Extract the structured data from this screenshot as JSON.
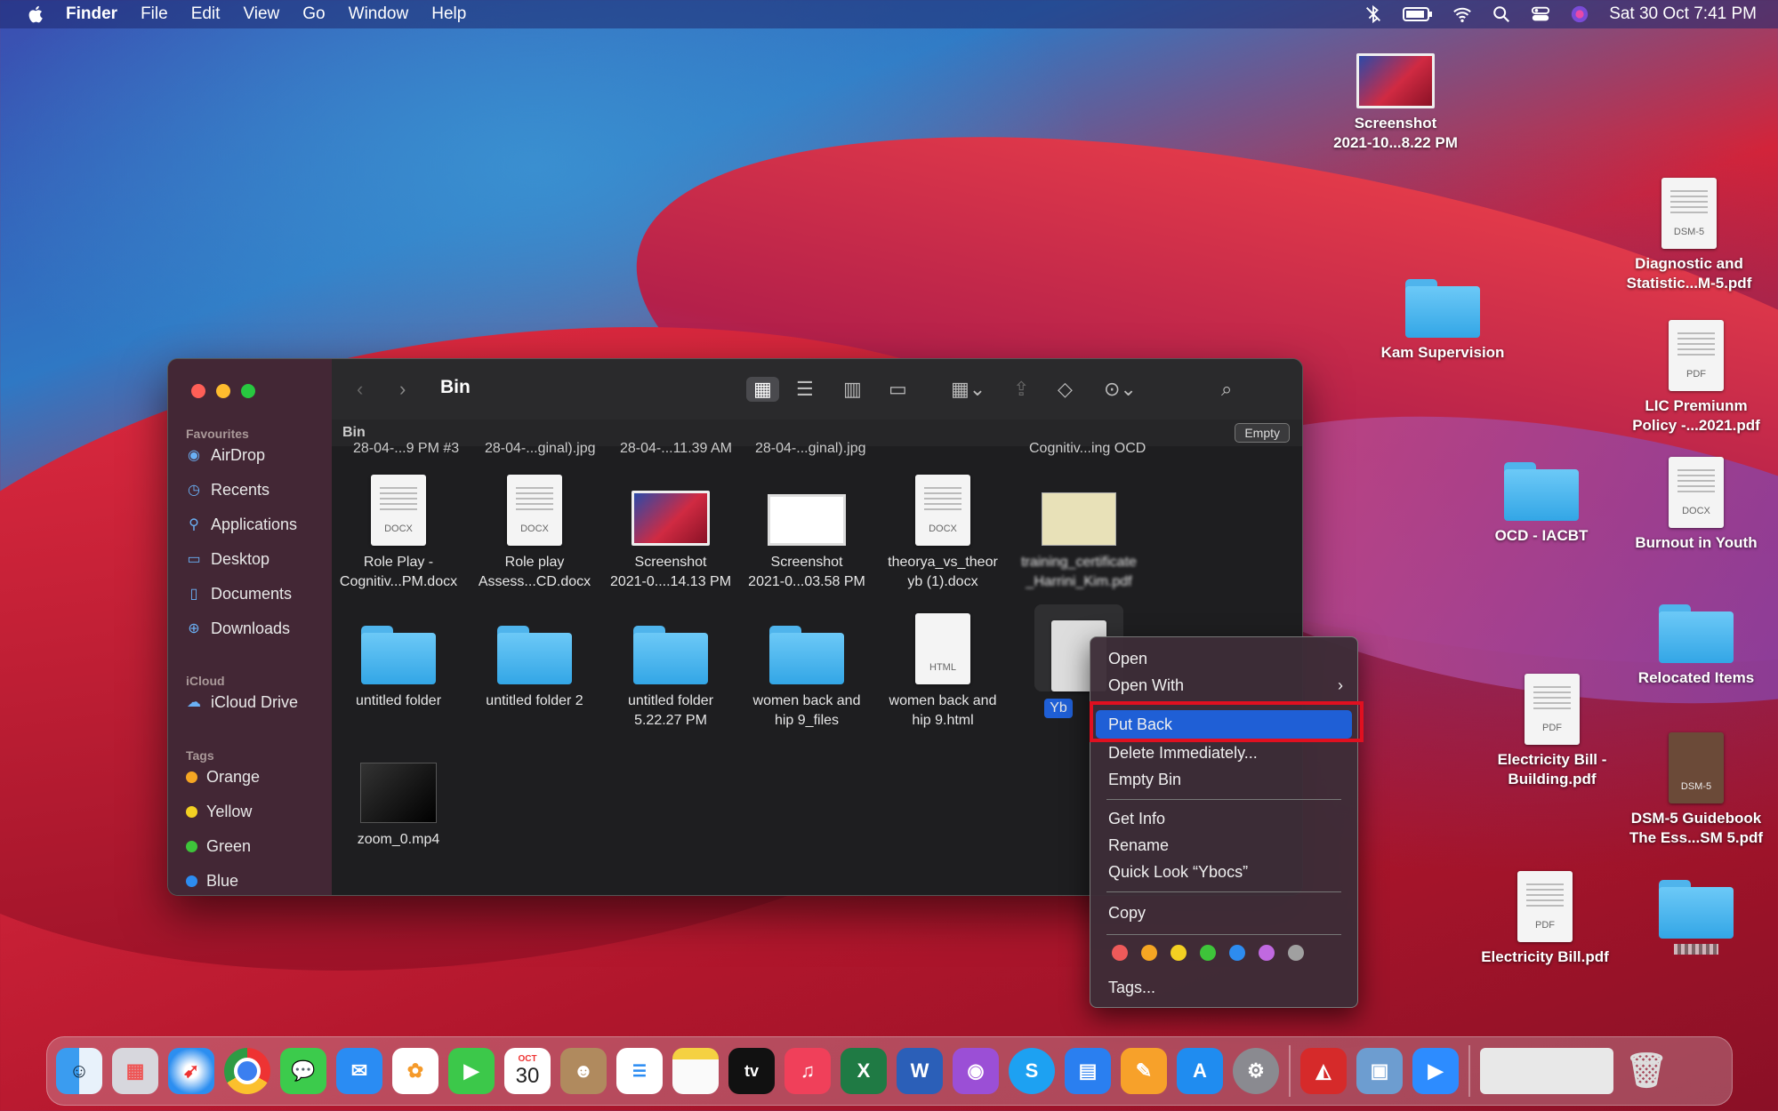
{
  "menubar": {
    "app": "Finder",
    "items": [
      "File",
      "Edit",
      "View",
      "Go",
      "Window",
      "Help"
    ],
    "datetime": "Sat 30 Oct  7:41 PM"
  },
  "desktop_icons": [
    {
      "label1": "Screenshot",
      "label2": "2021-10...8.22 PM",
      "kind": "screenshot"
    },
    {
      "label1": "Kam Supervision",
      "label2": "",
      "kind": "folder"
    },
    {
      "label1": "Diagnostic and",
      "label2": "Statistic...M-5.pdf",
      "kind": "pdf"
    },
    {
      "label1": "LIC Premiunm",
      "label2": "Policy -...2021.pdf",
      "kind": "pdf"
    },
    {
      "label1": "OCD - IACBT",
      "label2": "",
      "kind": "folder"
    },
    {
      "label1": "Burnout in Youth",
      "label2": "",
      "kind": "docx"
    },
    {
      "label1": "Relocated Items",
      "label2": "",
      "kind": "folder"
    },
    {
      "label1": "Electricity Bill -",
      "label2": "Building.pdf",
      "kind": "pdf"
    },
    {
      "label1": "DSM-5 Guidebook",
      "label2": "The Ess...SM 5.pdf",
      "kind": "book"
    },
    {
      "label1": "Electricity Bill.pdf",
      "label2": "",
      "kind": "pdf"
    },
    {
      "label1": "",
      "label2": "",
      "kind": "folder"
    }
  ],
  "finder": {
    "title": "Bin",
    "path_label": "Bin",
    "empty_button": "Empty",
    "sidebar": {
      "favourites_header": "Favourites",
      "favourites": [
        "AirDrop",
        "Recents",
        "Applications",
        "Desktop",
        "Documents",
        "Downloads"
      ],
      "icloud_header": "iCloud",
      "icloud": [
        "iCloud Drive"
      ],
      "tags_header": "Tags",
      "tags": [
        {
          "label": "Orange",
          "color": "#f5a623"
        },
        {
          "label": "Yellow",
          "color": "#f3d022"
        },
        {
          "label": "Green",
          "color": "#3ec43a"
        },
        {
          "label": "Blue",
          "color": "#2d8cf0"
        }
      ]
    },
    "truncated_row": [
      "28-04-...9 PM #3",
      "28-04-...ginal).jpg",
      "28-04-...11.39 AM",
      "28-04-...ginal).jpg",
      "Cognitiv...ing OCD"
    ],
    "files": [
      {
        "l1": "Role Play -",
        "l2": "Cognitiv...PM.docx",
        "kind": "docx"
      },
      {
        "l1": "Role play",
        "l2": "Assess...CD.docx",
        "kind": "docx"
      },
      {
        "l1": "Screenshot",
        "l2": "2021-0....14.13 PM",
        "kind": "screenshot"
      },
      {
        "l1": "Screenshot",
        "l2": "2021-0...03.58 PM",
        "kind": "screenshot2"
      },
      {
        "l1": "theorya_vs_theor",
        "l2": "yb (1).docx",
        "kind": "docx"
      },
      {
        "l1": "training_certificate",
        "l2": "_Harrini_Kim.pdf",
        "kind": "cert"
      },
      {
        "l1": "untitled folder",
        "l2": "",
        "kind": "folder"
      },
      {
        "l1": "untitled folder 2",
        "l2": "",
        "kind": "folder"
      },
      {
        "l1": "untitled folder",
        "l2": "5.22.27 PM",
        "kind": "folder"
      },
      {
        "l1": "women back and",
        "l2": "hip 9_files",
        "kind": "folder"
      },
      {
        "l1": "women back and",
        "l2": "hip 9.html",
        "kind": "html"
      },
      {
        "l1": "Yb",
        "l2": "",
        "kind": "selected"
      },
      {
        "l1": "zoom_0.mp4",
        "l2": "",
        "kind": "video"
      }
    ]
  },
  "context_menu": {
    "items": [
      "Open",
      "Open With",
      "Put Back",
      "Delete Immediately...",
      "Empty Bin",
      "Get Info",
      "Rename",
      "Quick Look “Ybocs”",
      "Copy",
      "Tags..."
    ],
    "highlighted": "Put Back",
    "tag_colors": [
      "#ee5a5a",
      "#f5a623",
      "#f3d022",
      "#3ec43a",
      "#2d8cf0",
      "#c069e0",
      "#a0a0a0"
    ]
  },
  "dock": {
    "apps": [
      "Finder",
      "Launchpad",
      "Safari",
      "Chrome",
      "Messages",
      "Mail",
      "Photos",
      "FaceTime",
      "Calendar",
      "Contacts",
      "Reminders",
      "Notes",
      "TV",
      "Music",
      "Excel",
      "Word",
      "Podcasts",
      "Skype",
      "Keynote",
      "Pages",
      "App Store",
      "System Preferences",
      "Acrobat",
      "Preview",
      "Zoom",
      "Downloads",
      "Bin"
    ],
    "calendar_month": "OCT",
    "calendar_day": "30",
    "tv_label": "tv"
  }
}
